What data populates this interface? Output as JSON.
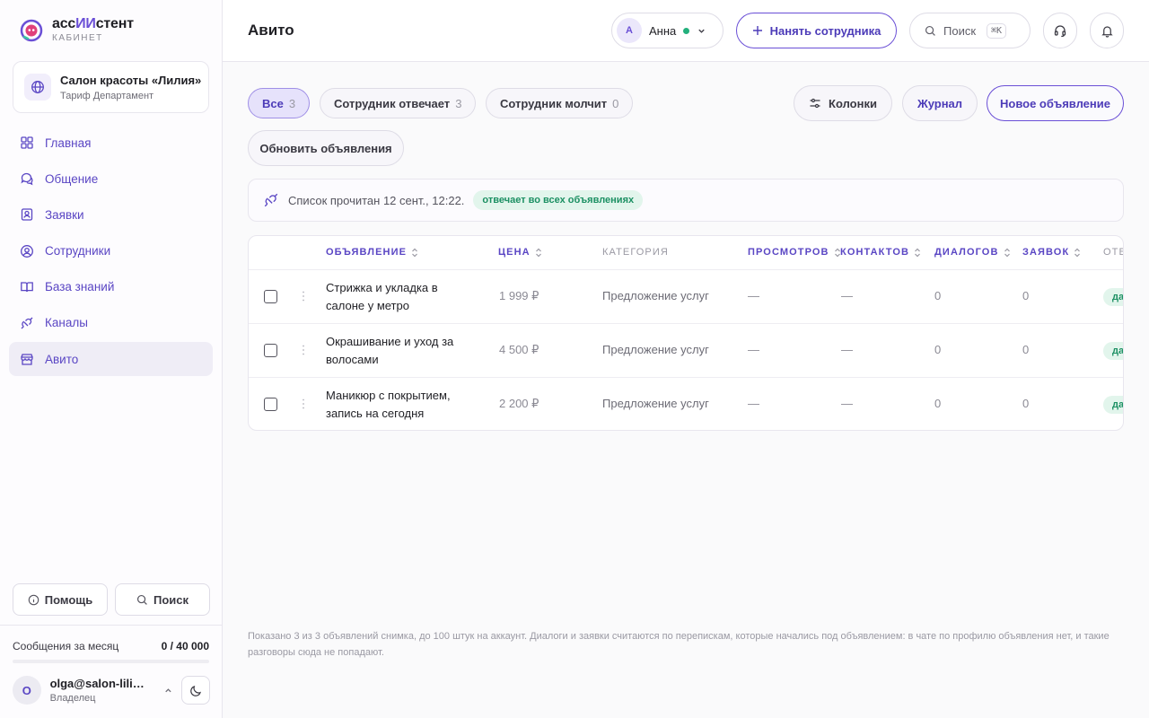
{
  "brand": {
    "name_prefix": "асс",
    "name_accent": "ИИ",
    "name_suffix": "стент",
    "subtitle": "КАБИНЕТ"
  },
  "org": {
    "title": "Салон красоты «Лилия»",
    "plan": "Тариф Департамент"
  },
  "nav": [
    {
      "label": "Главная",
      "icon": "grid-icon"
    },
    {
      "label": "Общение",
      "icon": "chat-icon"
    },
    {
      "label": "Заявки",
      "icon": "requests-icon"
    },
    {
      "label": "Сотрудники",
      "icon": "user-circle-icon"
    },
    {
      "label": "База знаний",
      "icon": "book-icon"
    },
    {
      "label": "Каналы",
      "icon": "plug-icon"
    },
    {
      "label": "Авито",
      "icon": "store-icon",
      "active": true
    }
  ],
  "sidebar_buttons": {
    "help": "Помощь",
    "search": "Поиск"
  },
  "quota": {
    "label": "Сообщения за месяц",
    "value": "0 / 40 000",
    "fraction": 0
  },
  "user": {
    "initial": "O",
    "email": "olga@salon-liliya.ru",
    "role": "Владелец"
  },
  "header": {
    "title": "Авито",
    "employee": {
      "initial": "А",
      "name": "Анна",
      "status_color": "#23b07c"
    },
    "hire_label": "Нанять сотрудника",
    "search_label": "Поиск",
    "search_kbd": "⌘K"
  },
  "filters": [
    {
      "label": "Все",
      "count": "3",
      "active": true
    },
    {
      "label": "Сотрудник отвечает",
      "count": "3"
    },
    {
      "label": "Сотрудник молчит",
      "count": "0"
    }
  ],
  "actions": {
    "columns": "Колонки",
    "journal": "Журнал",
    "new_ad": "Новое объявление",
    "refresh": "Обновить объявления"
  },
  "status": {
    "text": "Список прочитан 12 сент., 12:22.",
    "badge": "отвечает во всех объявлениях"
  },
  "table": {
    "columns": {
      "title": "ОБЪЯВЛЕНИЕ",
      "price": "ЦЕНА",
      "category": "КАТЕГОРИЯ",
      "views": "ПРОСМОТРОВ",
      "contacts": "КОНТАКТОВ",
      "dialogs": "ДИАЛОГОВ",
      "requests": "ЗАЯВОК",
      "reply": "ОТВЕЧАЕТ"
    },
    "rows": [
      {
        "title": "Стрижка и укладка в салоне у метро",
        "price": "1 999 ₽",
        "category": "Предложение услуг",
        "views": "—",
        "contacts": "—",
        "dialogs": "0",
        "requests": "0",
        "reply": "да"
      },
      {
        "title": "Окрашивание и уход за волосами",
        "price": "4 500 ₽",
        "category": "Предложение услуг",
        "views": "—",
        "contacts": "—",
        "dialogs": "0",
        "requests": "0",
        "reply": "да"
      },
      {
        "title": "Маникюр с покрытием, запись на сегодня",
        "price": "2 200 ₽",
        "category": "Предложение услуг",
        "views": "—",
        "contacts": "—",
        "dialogs": "0",
        "requests": "0",
        "reply": "да"
      }
    ]
  },
  "footnote": "Показано 3 из 3 объявлений снимка, до 100 штук на аккаунт. Диалоги и заявки считаются по перепискам, которые начались под объявлением: в чате по профилю объявления нет, и такие разговоры сюда не попадают."
}
